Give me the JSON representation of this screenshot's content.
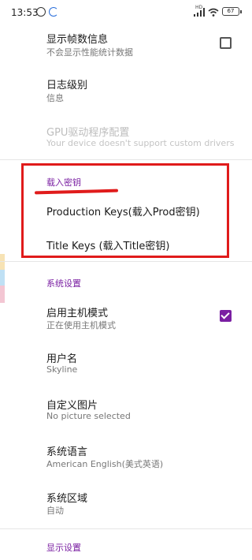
{
  "status_bar": {
    "time": "13:53",
    "network_label": "HD",
    "battery": "67"
  },
  "settings": [
    {
      "title": "显示帧数信息",
      "subtitle": "不会显示性能统计数据",
      "checkbox": false
    },
    {
      "title": "日志级别",
      "subtitle": "信息"
    },
    {
      "title": "GPU驱动程序配置",
      "subtitle": "Your device doesn't support custom drivers",
      "disabled": true
    }
  ],
  "keys_section": {
    "header": "载入密钥",
    "items": [
      {
        "title": "Production Keys(载入Prod密钥)"
      },
      {
        "title": "Title Keys (载入Title密钥)"
      }
    ]
  },
  "system_section": {
    "header": "系统设置",
    "items": [
      {
        "title": "启用主机模式",
        "subtitle": "正在使用主机模式",
        "checkbox": true
      },
      {
        "title": "用户名",
        "subtitle": "Skyline"
      },
      {
        "title": "自定义图片",
        "subtitle": "No picture selected"
      },
      {
        "title": "系统语言",
        "subtitle": "American English(美式英语)"
      },
      {
        "title": "系统区域",
        "subtitle": "自动"
      }
    ]
  },
  "display_section": {
    "header": "显示设置"
  },
  "colors": {
    "accent": "#7a1fa2",
    "annotation": "#e01b1b"
  }
}
